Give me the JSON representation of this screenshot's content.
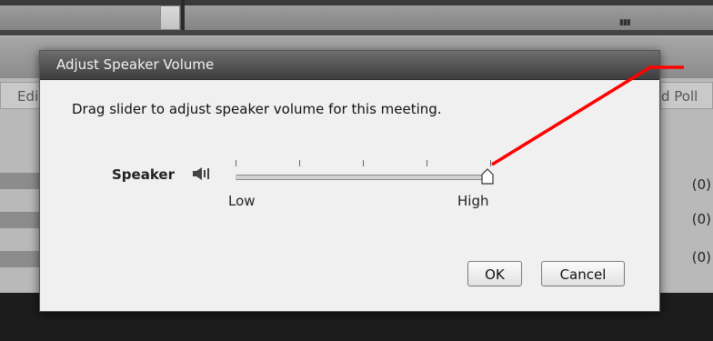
{
  "background": {
    "tabs": {
      "left_partial": "Edi",
      "right_partial": "d Poll"
    },
    "counts": [
      "(0)",
      "(0)",
      "(0)"
    ]
  },
  "dialog": {
    "title": "Adjust Speaker Volume",
    "instruction": "Drag slider to adjust speaker volume for this meeting.",
    "speaker_label": "Speaker",
    "slider": {
      "min_label": "Low",
      "max_label": "High",
      "value_fraction": 1.0,
      "tick_count": 5
    },
    "ok_label": "OK",
    "cancel_label": "Cancel"
  },
  "colors": {
    "annotation": "#ff0000"
  }
}
